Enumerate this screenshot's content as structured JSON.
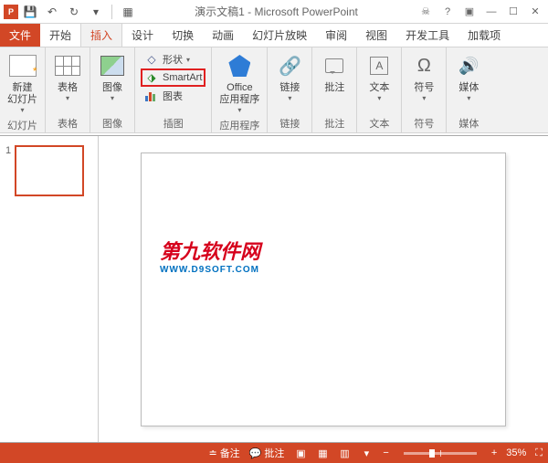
{
  "title": "演示文稿1 - Microsoft PowerPoint",
  "tabs": {
    "file": "文件",
    "home": "开始",
    "insert": "插入",
    "design": "设计",
    "transitions": "切换",
    "animations": "动画",
    "slideshow": "幻灯片放映",
    "review": "审阅",
    "view": "视图",
    "developer": "开发工具",
    "addins": "加载项"
  },
  "ribbon": {
    "slides": {
      "label": "幻灯片",
      "newSlide": "新建\n幻灯片"
    },
    "tables": {
      "label": "表格",
      "table": "表格"
    },
    "images": {
      "label": "图像",
      "image": "图像"
    },
    "illustrations": {
      "label": "插图",
      "shapes": "形状",
      "smartart": "SmartArt",
      "chart": "图表"
    },
    "apps": {
      "label": "应用程序",
      "office": "Office\n应用程序"
    },
    "links": {
      "label": "链接",
      "link": "链接"
    },
    "comments": {
      "label": "批注",
      "comment": "批注"
    },
    "text": {
      "label": "文本",
      "textbox": "文本"
    },
    "symbols": {
      "label": "符号",
      "symbol": "符号"
    },
    "media": {
      "label": "媒体",
      "media": "媒体"
    }
  },
  "slideNum": "1",
  "watermark": {
    "main": "第九软件网",
    "sub": "WWW.D9SOFT.COM"
  },
  "status": {
    "notes": "备注",
    "comments": "批注",
    "zoom": "35%"
  }
}
